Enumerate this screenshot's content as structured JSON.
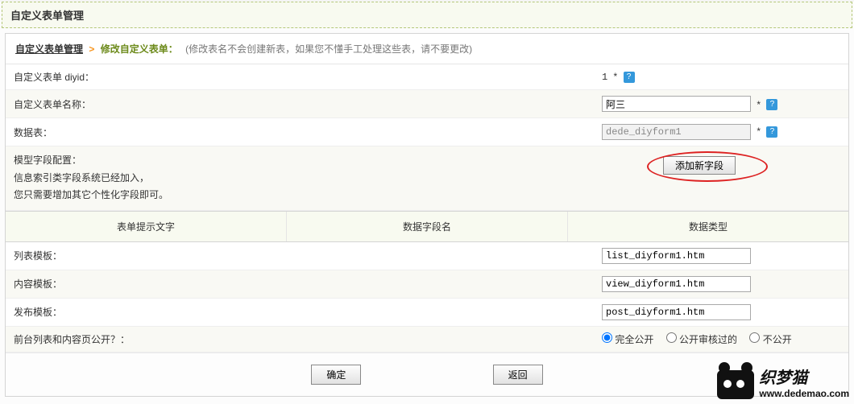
{
  "header": {
    "title": "自定义表单管理"
  },
  "breadcrumb": {
    "link": "自定义表单管理",
    "current": "修改自定义表单：",
    "note": "(修改表名不会创建新表，如果您不懂手工处理这些表，请不要更改)"
  },
  "form": {
    "diyid_label": "自定义表单 diyid：",
    "diyid_value": "1",
    "name_label": "自定义表单名称：",
    "name_value": "阿三",
    "table_label": "数据表：",
    "table_value": "dede_diyform1",
    "field_label": "模型字段配置：",
    "field_desc1": "信息索引类字段系统已经加入，",
    "field_desc2": "您只需要增加其它个性化字段即可。",
    "add_field_btn": "添加新字段",
    "list_tpl_label": "列表模板：",
    "list_tpl_value": "list_diyform1.htm",
    "content_tpl_label": "内容模板：",
    "content_tpl_value": "view_diyform1.htm",
    "post_tpl_label": "发布模板：",
    "post_tpl_value": "post_diyform1.htm",
    "public_label": "前台列表和内容页公开？：",
    "public_options": [
      "完全公开",
      "公开审核过的",
      "不公开"
    ]
  },
  "columns": {
    "c1": "表单提示文字",
    "c2": "数据字段名",
    "c3": "数据类型"
  },
  "actions": {
    "ok": "确定",
    "back": "返回"
  },
  "watermark": {
    "name": "织梦猫",
    "url": "www.dedemao.com"
  },
  "icons": {
    "help": "?"
  }
}
